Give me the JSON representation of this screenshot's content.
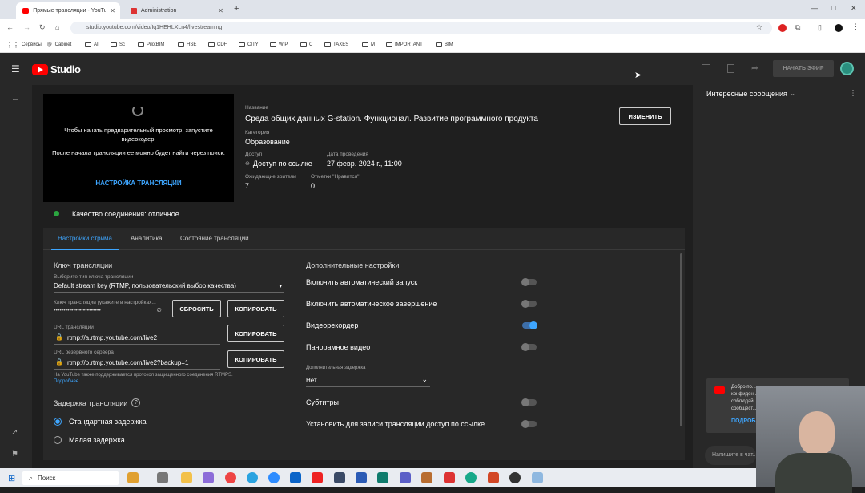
{
  "browser": {
    "tabs": [
      {
        "label": "Прямые трансляции - YouTub",
        "active": true
      },
      {
        "label": "Administration",
        "active": false
      }
    ],
    "url": "studio.youtube.com/video/Iq1HEHLXLn4/livestreaming",
    "bookmarks": [
      "Сервисы",
      "Cabinet",
      "AI",
      "Sc",
      "PilotBIM",
      "HSE",
      "CDF",
      "CITY",
      "WIP",
      "C",
      "TAXES",
      "M",
      "IMPORTANT",
      "BIM"
    ]
  },
  "header": {
    "logo": "Studio",
    "go_live_label": "НАЧАТЬ ЭФИР"
  },
  "preview": {
    "message": "Чтобы начать предварительный просмотр, запустите видеокодер.",
    "message2": "После начала трансляции ее можно будет найти через поиск.",
    "settings_link": "НАСТРОЙКА ТРАНСЛЯЦИИ"
  },
  "details": {
    "title_label": "Название",
    "title": "Среда общих данных G-station. Функционал. Развитие программного продукта",
    "category_label": "Категория",
    "category": "Образование",
    "access_label": "Доступ",
    "access": "Доступ по ссылке",
    "date_label": "Дата проведения",
    "date": "27 февр. 2024 г., 11:00",
    "viewers_label": "Ожидающие зрители",
    "viewers": "7",
    "likes_label": "Отметки \"Нравится\"",
    "likes": "0",
    "edit_label": "ИЗМЕНИТЬ"
  },
  "connection": {
    "text": "Качество соединения: отличное",
    "color": "#2ba640"
  },
  "tabs": [
    "Настройки стрима",
    "Аналитика",
    "Состояние трансляции"
  ],
  "stream": {
    "key_heading": "Ключ трансляции",
    "key_type_label": "Выберите тип ключа трансляции",
    "key_type": "Default stream key (RTMP, пользовательский выбор качества)",
    "key_label": "Ключ трансляции (укажите в настройках...",
    "key_value": "••••••••••••••••••••••••",
    "reset_label": "СБРОСИТЬ",
    "copy_label": "КОПИРОВАТЬ",
    "url_label": "URL трансляции",
    "url": "rtmp://a.rtmp.youtube.com/live2",
    "backup_label": "URL резервного сервера",
    "backup_url": "rtmp://b.rtmp.youtube.com/live2?backup=1",
    "rtmps_note": "На YouTube также поддерживается протокол защищенного соединения RTMPS.",
    "more_link": "Подробнее...",
    "latency_heading": "Задержка трансляции",
    "latency_options": [
      "Стандартная задержка",
      "Малая задержка"
    ]
  },
  "extra": {
    "heading": "Дополнительные настройки",
    "toggles": [
      {
        "label": "Включить автоматический запуск",
        "on": false
      },
      {
        "label": "Включить автоматическое завершение",
        "on": false
      },
      {
        "label": "Видеорекордер",
        "on": true
      },
      {
        "label": "Панорамное видео",
        "on": false
      }
    ],
    "delay_label": "Дополнительная задержка",
    "delay_value": "Нет",
    "toggles2": [
      {
        "label": "Субтитры",
        "on": false
      },
      {
        "label": "Установить для записи трансляции доступ по ссылке",
        "on": false
      }
    ]
  },
  "chat": {
    "heading": "Интересные сообщения",
    "toast": "Добро по... конфиден... соблюдай... сообщест...",
    "toast_link": "ПОДРОБ...",
    "input_placeholder": "Напишите в чат..."
  },
  "taskbar": {
    "search": "Поиск"
  }
}
